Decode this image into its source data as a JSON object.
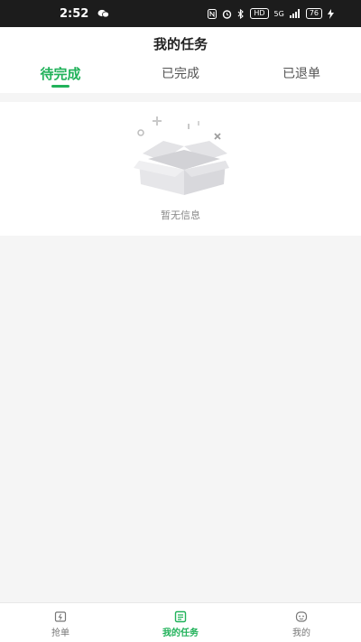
{
  "status_bar": {
    "time": "2:52",
    "icons": [
      "wechat-icon",
      "nfc-icon",
      "alarm-icon",
      "bluetooth-icon",
      "hd-icon",
      "signal-icon",
      "charging-icon"
    ],
    "hd": "HD",
    "network": "5G",
    "battery": "76"
  },
  "header": {
    "title": "我的任务"
  },
  "tabs": [
    {
      "label": "待完成",
      "active": true
    },
    {
      "label": "已完成",
      "active": false
    },
    {
      "label": "已退单",
      "active": false
    }
  ],
  "empty_state": {
    "message": "暂无信息",
    "icon": "empty-box-icon"
  },
  "bottom_nav": [
    {
      "label": "抢单",
      "icon": "grab-order-icon",
      "active": false
    },
    {
      "label": "我的任务",
      "icon": "task-list-icon",
      "active": true
    },
    {
      "label": "我的",
      "icon": "profile-icon",
      "active": false
    }
  ],
  "colors": {
    "accent": "#21b25a",
    "background": "#f5f5f5",
    "statusbar": "#1c1c1c"
  }
}
